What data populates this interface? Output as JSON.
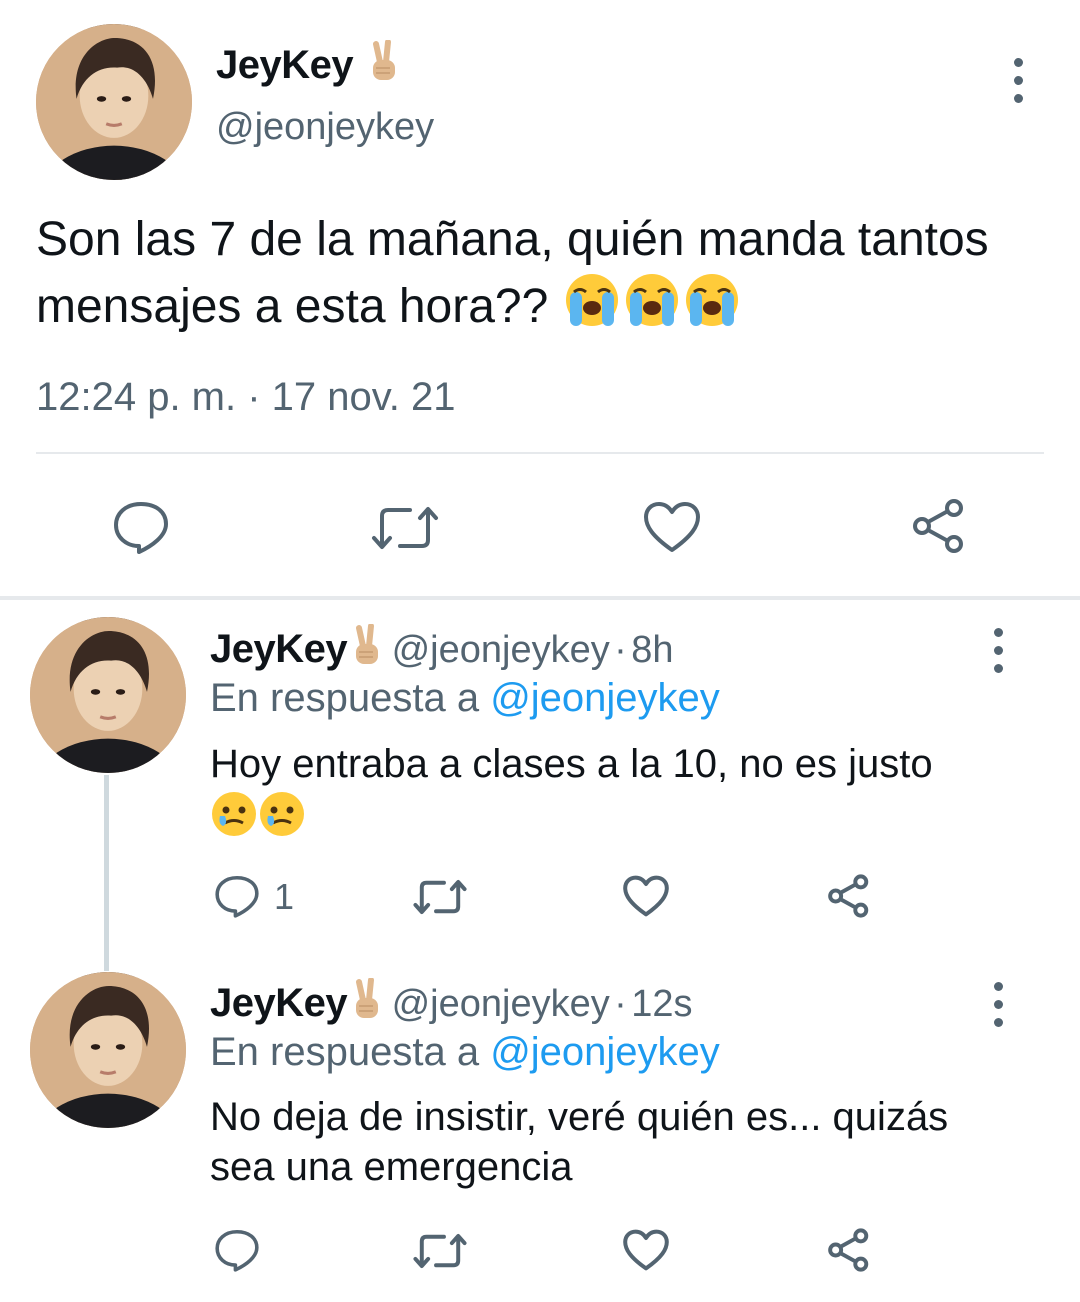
{
  "main_tweet": {
    "display_name": "JeyKey",
    "name_emoji": "victory-hand-emoji",
    "handle": "@jeonjeykey",
    "text": "Son las 7 de la mañana, quién manda tantos mensajes a esta hora??",
    "trailing_emojis": [
      "loudly-crying-face-emoji",
      "loudly-crying-face-emoji",
      "loudly-crying-face-emoji"
    ],
    "timestamp": "12:24 p. m. · 17 nov. 21",
    "actions": [
      "reply-icon",
      "retweet-icon",
      "like-icon",
      "share-icon"
    ]
  },
  "replies": [
    {
      "display_name": "JeyKey",
      "handle": "@jeonjeykey",
      "sep": "·",
      "time": "8h",
      "reply_prefix": "En respuesta a",
      "reply_to": "@jeonjeykey",
      "line1": "Hoy entraba a clases a la 10, no es justo",
      "emojis": [
        "face-holding-back-tears-emoji",
        "face-holding-back-tears-emoji"
      ],
      "reply_count": "1"
    },
    {
      "display_name": "JeyKey",
      "handle": "@jeonjeykey",
      "sep": "·",
      "time": "12s",
      "reply_prefix": "En respuesta a",
      "reply_to": "@jeonjeykey",
      "line1": "No deja de insistir, veré quién es... quizás",
      "line2": "sea una emergencia",
      "reply_count": ""
    }
  ],
  "colors": {
    "text": "#0f1419",
    "muted": "#536471",
    "link": "#1d9bf0",
    "divider": "#e6e9ec"
  }
}
